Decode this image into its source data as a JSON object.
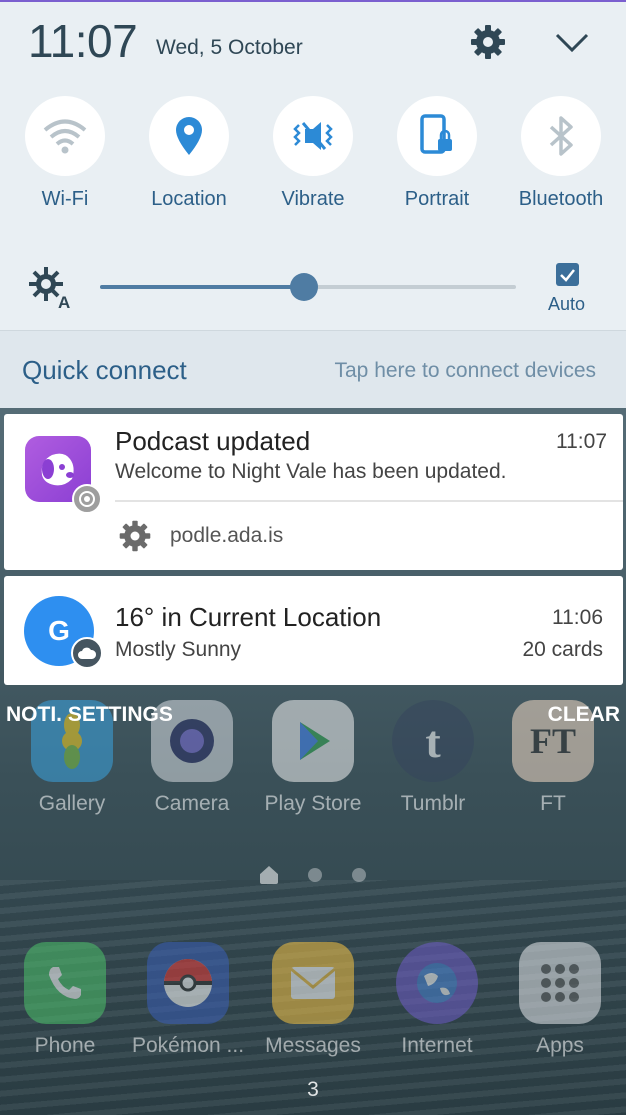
{
  "status": {
    "time": "11:07",
    "date": "Wed, 5 October"
  },
  "quick_toggles": [
    {
      "label": "Wi-Fi",
      "icon": "wifi-icon",
      "active": false
    },
    {
      "label": "Location",
      "icon": "location-pin-icon",
      "active": true
    },
    {
      "label": "Vibrate",
      "icon": "vibrate-icon",
      "active": true
    },
    {
      "label": "Portrait",
      "icon": "portrait-lock-icon",
      "active": true
    },
    {
      "label": "Bluetooth",
      "icon": "bluetooth-icon",
      "active": false
    }
  ],
  "brightness": {
    "level": 0.49,
    "auto_label": "Auto",
    "auto_checked": true
  },
  "quick_connect": {
    "title": "Quick connect",
    "hint": "Tap here to connect devices"
  },
  "notifications": [
    {
      "title": "Podcast updated",
      "time": "11:07",
      "text": "Welcome to Night Vale has been updated.",
      "source": "podle.ada.is"
    },
    {
      "title": "16° in Current Location",
      "time": "11:06",
      "text": "Mostly Sunny",
      "extra": "20 cards",
      "icon_letter": "G"
    }
  ],
  "actions": {
    "settings_label": "NOTI. SETTINGS",
    "clear_label": "CLEAR"
  },
  "home_apps": [
    {
      "label": "Gallery"
    },
    {
      "label": "Camera"
    },
    {
      "label": "Play Store"
    },
    {
      "label": "Tumblr"
    },
    {
      "label": "FT"
    }
  ],
  "dock_apps": [
    {
      "label": "Phone"
    },
    {
      "label": "Pokémon ..."
    },
    {
      "label": "Messages"
    },
    {
      "label": "Internet"
    },
    {
      "label": "Apps"
    }
  ],
  "badge": "3",
  "colors": {
    "accent": "#2c5f88",
    "panel": "#e9eff3",
    "top_line": "#7b5fcf"
  }
}
